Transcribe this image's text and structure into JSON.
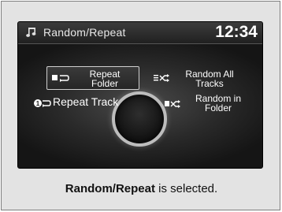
{
  "screen": {
    "title": "Random/Repeat",
    "clock": "12:34",
    "title_icon": "music-note-icon",
    "options": [
      {
        "label": "Repeat Folder",
        "icon": "repeat-folder-icon",
        "selected": true
      },
      {
        "label": "Random All Tracks",
        "icon": "random-all-icon",
        "selected": false
      },
      {
        "label": "Repeat Track",
        "icon": "repeat-track-icon",
        "selected": false
      },
      {
        "label": "Random in Folder",
        "icon": "random-folder-icon",
        "selected": false
      }
    ]
  },
  "caption": {
    "bold": "Random/Repeat",
    "rest": " is selected."
  },
  "colors": {
    "panel_bg": "#e3e3e3",
    "screen_bg": "#181818",
    "text": "#ffffff"
  }
}
